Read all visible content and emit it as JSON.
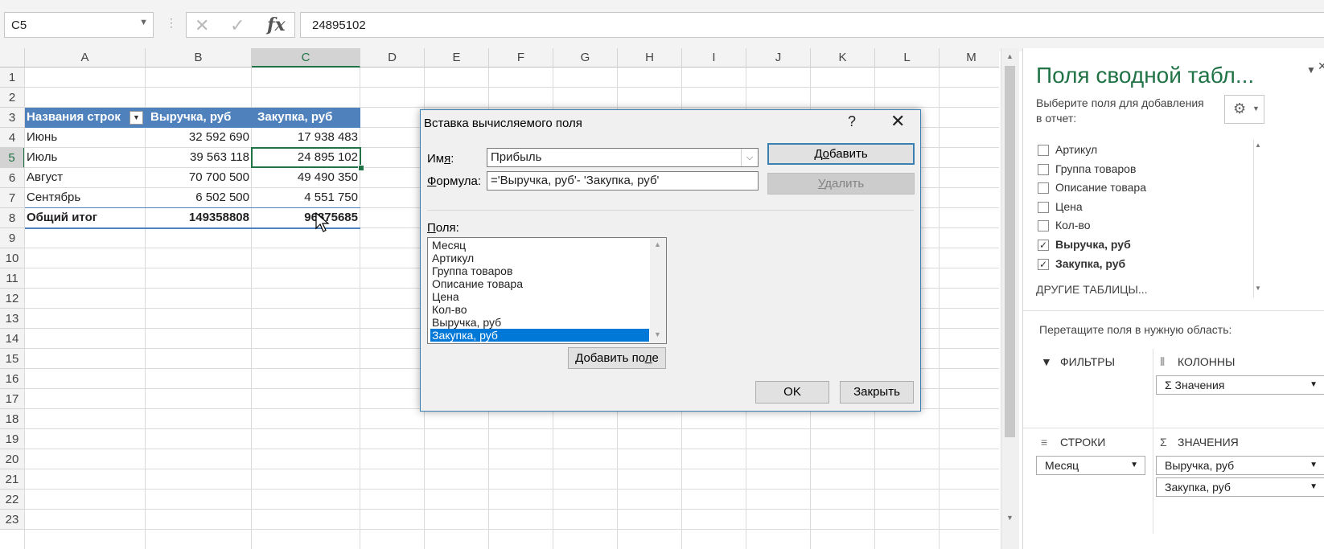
{
  "formula_bar": {
    "name_box": "C5",
    "formula_value": "24895102",
    "icons": [
      "cancel-icon",
      "enter-icon",
      "fx-icon"
    ]
  },
  "grid": {
    "columns": [
      "A",
      "B",
      "C",
      "D",
      "E",
      "F",
      "G",
      "H",
      "I",
      "J",
      "K",
      "L",
      "M"
    ],
    "rows": [
      "1",
      "2",
      "3",
      "4",
      "5",
      "6",
      "7",
      "8",
      "9",
      "10",
      "11",
      "12",
      "13",
      "14",
      "15",
      "16",
      "17",
      "18",
      "19",
      "20",
      "21",
      "22",
      "23"
    ],
    "selected_column": "C",
    "selected_row": "5"
  },
  "pivot": {
    "headers": [
      "Названия строк",
      "Выручка, руб",
      "Закупка, руб"
    ],
    "rows": [
      [
        "Июнь",
        "32 592 690",
        "17 938 483"
      ],
      [
        "Июль",
        "39 563 118",
        "24 895 102"
      ],
      [
        "Август",
        "70 700 500",
        "49 490 350"
      ],
      [
        "Сентябрь",
        "6 502 500",
        "4 551 750"
      ]
    ],
    "total": [
      "Общий итог",
      "149358808",
      "96875685"
    ]
  },
  "dialog": {
    "title": "Вставка вычисляемого поля",
    "help": "?",
    "close": "✕",
    "name_label_pre": "Им",
    "name_label_ul": "я",
    "name_label_post": ":",
    "name_value": "Прибыль",
    "formula_label_pre": "",
    "formula_label_ul": "Ф",
    "formula_label_post": "ормула:",
    "formula_value": "='Выручка, руб'- 'Закупка, руб'",
    "add_btn_pre": "Д",
    "add_btn_ul": "о",
    "add_btn_post": "бавить",
    "delete_btn_pre": "",
    "delete_btn_ul": "У",
    "delete_btn_post": "далить",
    "fields_label_pre": "",
    "fields_label_ul": "П",
    "fields_label_post": "оля:",
    "fields": [
      "Месяц",
      "Артикул",
      "Группа товаров",
      "Описание товара",
      "Цена",
      "Кол-во",
      "Выручка, руб",
      "Закупка, руб"
    ],
    "selected_field_index": 7,
    "add_field_btn_pre": "Добавить по",
    "add_field_btn_ul": "л",
    "add_field_btn_post": "е",
    "ok_btn": "OK",
    "close_btn": "Закрыть"
  },
  "pane": {
    "title": "Поля сводной табл...",
    "instruction": "Выберите поля для добавления",
    "instruction2": "в отчет:",
    "fields": [
      {
        "label": "Артикул",
        "checked": false
      },
      {
        "label": "Группа товаров",
        "checked": false
      },
      {
        "label": "Описание товара",
        "checked": false
      },
      {
        "label": "Цена",
        "checked": false
      },
      {
        "label": "Кол-во",
        "checked": false
      },
      {
        "label": "Выручка, руб",
        "checked": true
      },
      {
        "label": "Закупка, руб",
        "checked": true
      }
    ],
    "other_tables": "ДРУГИЕ ТАБЛИЦЫ...",
    "drag_text": "Перетащите поля в нужную область:",
    "filters": "ФИЛЬТРЫ",
    "columns": "КОЛОННЫ",
    "columns_value": "Значения",
    "rows": "СТРОКИ",
    "rows_value": "Месяц",
    "values": "ЗНАЧЕНИЯ",
    "values_items": [
      "Выручка, руб",
      "Закупка, руб"
    ]
  },
  "colors": {
    "accent": "#217346",
    "pivot_header": "#4f81bd",
    "selection": "#0078d7"
  }
}
